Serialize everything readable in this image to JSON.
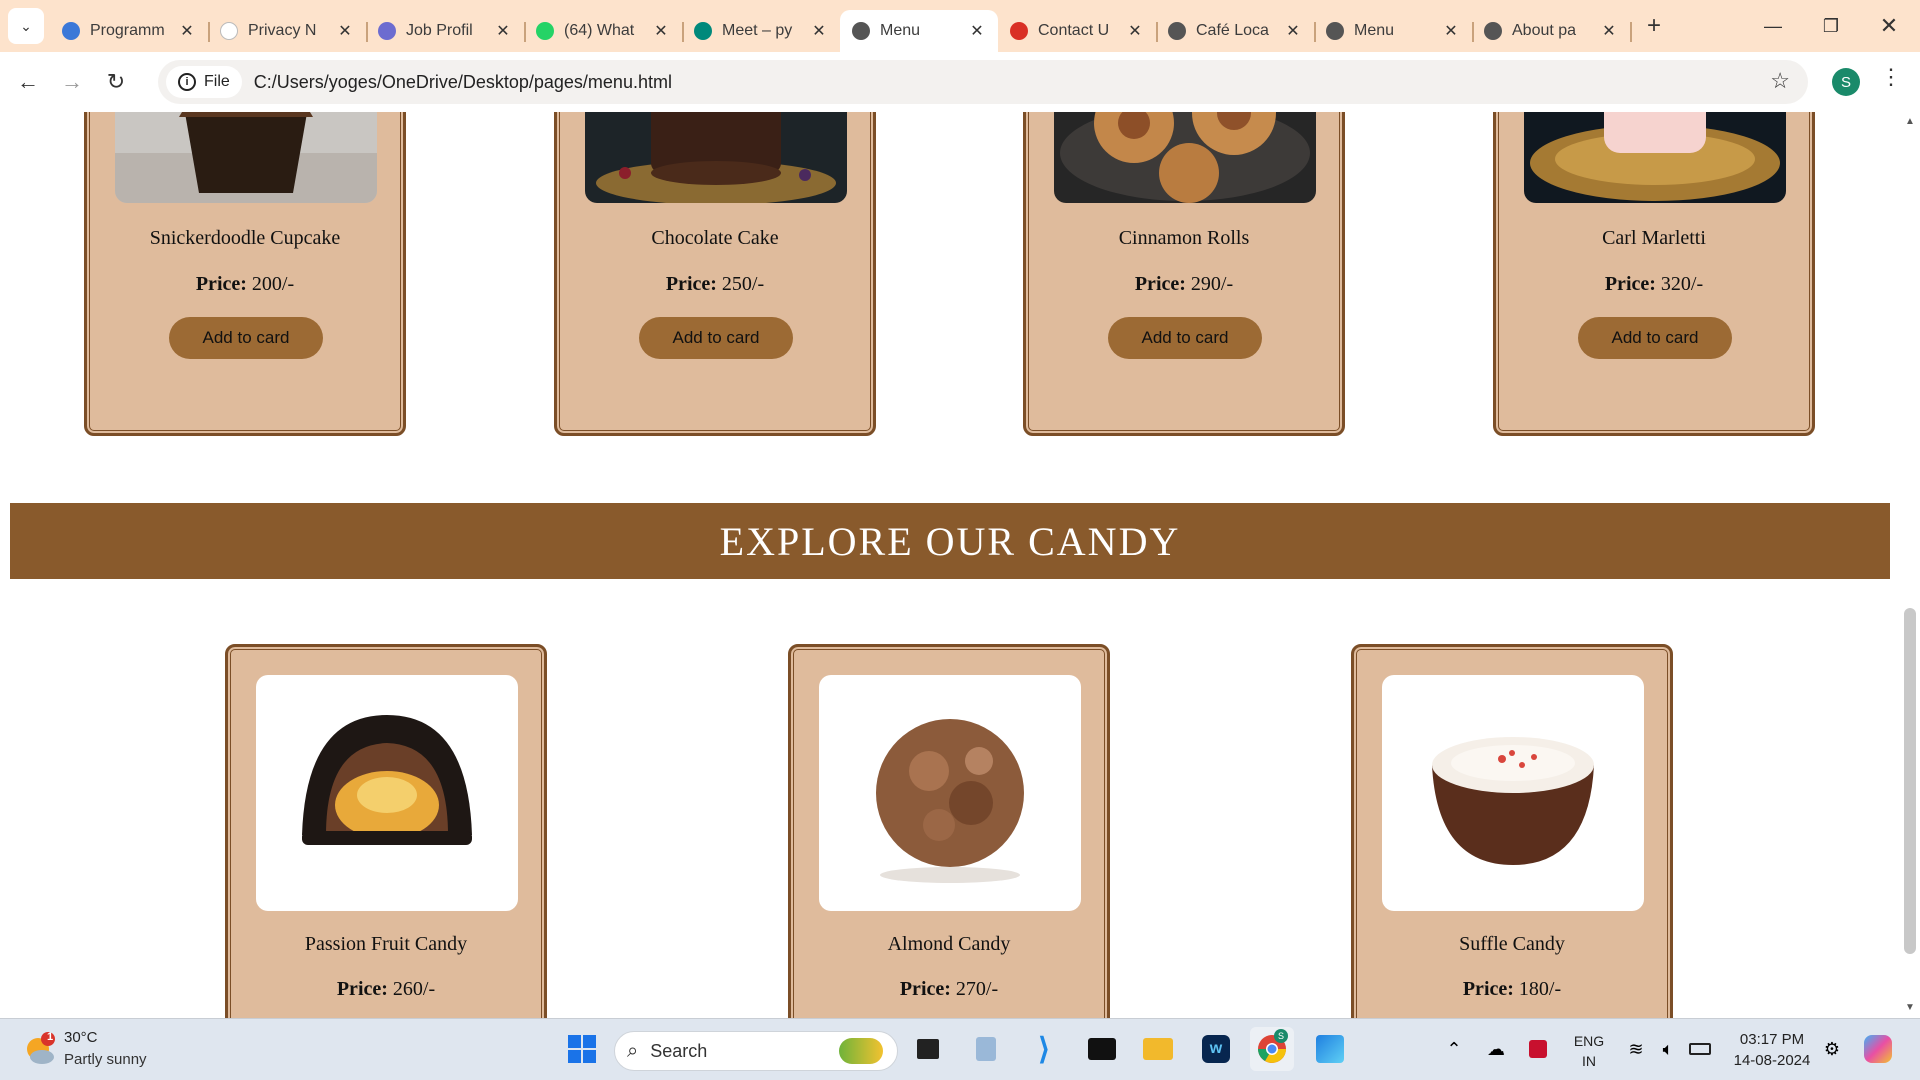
{
  "browser": {
    "tabs": [
      {
        "label": "Programm",
        "icon": "edge-icon",
        "color": "#3b78d8"
      },
      {
        "label": "Privacy N",
        "icon": "blank-page-icon",
        "color": "#ffffff"
      },
      {
        "label": "Job Profil",
        "icon": "stack-icon",
        "color": "#6c6cd0"
      },
      {
        "label": "(64) What",
        "icon": "whatsapp-icon",
        "color": "#25d366"
      },
      {
        "label": "Meet – py",
        "icon": "meet-icon",
        "color": "#00897b"
      },
      {
        "label": "Menu",
        "icon": "globe-icon",
        "color": "#555555",
        "active": true
      },
      {
        "label": "Contact U",
        "icon": "gmail-icon",
        "color": "#d93025"
      },
      {
        "label": "Café Loca",
        "icon": "globe-icon",
        "color": "#555555"
      },
      {
        "label": "Menu",
        "icon": "globe-icon",
        "color": "#555555"
      },
      {
        "label": "About pa",
        "icon": "globe-icon",
        "color": "#555555"
      }
    ],
    "new_tab": "+",
    "close_glyph": "✕",
    "address": {
      "chip": "File",
      "url": "C:/Users/yoges/OneDrive/Desktop/pages/menu.html"
    },
    "profile_initial": "S"
  },
  "page": {
    "cakes": [
      {
        "name": "Snickerdoodle Cupcake",
        "price_label": "Price:",
        "price": "200/-",
        "button": "Add to card"
      },
      {
        "name": "Chocolate Cake",
        "price_label": "Price:",
        "price": "250/-",
        "button": "Add to card"
      },
      {
        "name": "Cinnamon Rolls",
        "price_label": "Price:",
        "price": "290/-",
        "button": "Add to card"
      },
      {
        "name": "Carl Marletti",
        "price_label": "Price:",
        "price": "320/-",
        "button": "Add to card"
      }
    ],
    "candy_heading": "EXPLORE OUR CANDY",
    "candies": [
      {
        "name": "Passion Fruit Candy",
        "price_label": "Price:",
        "price": "260/-"
      },
      {
        "name": "Almond Candy",
        "price_label": "Price:",
        "price": "270/-"
      },
      {
        "name": "Suffle Candy",
        "price_label": "Price:",
        "price": "180/-"
      }
    ],
    "colors": {
      "card_bg": "#dfbb9c",
      "card_border": "#7b4e27",
      "banner": "#895a2c",
      "button": "#9c6a34"
    }
  },
  "taskbar": {
    "weather": {
      "temp": "30°C",
      "desc": "Partly sunny",
      "badge": "1"
    },
    "search_placeholder": "Search",
    "language": {
      "line1": "ENG",
      "line2": "IN"
    },
    "clock": {
      "time": "03:17 PM",
      "date": "14-08-2024"
    },
    "chrome_badge": "S"
  }
}
